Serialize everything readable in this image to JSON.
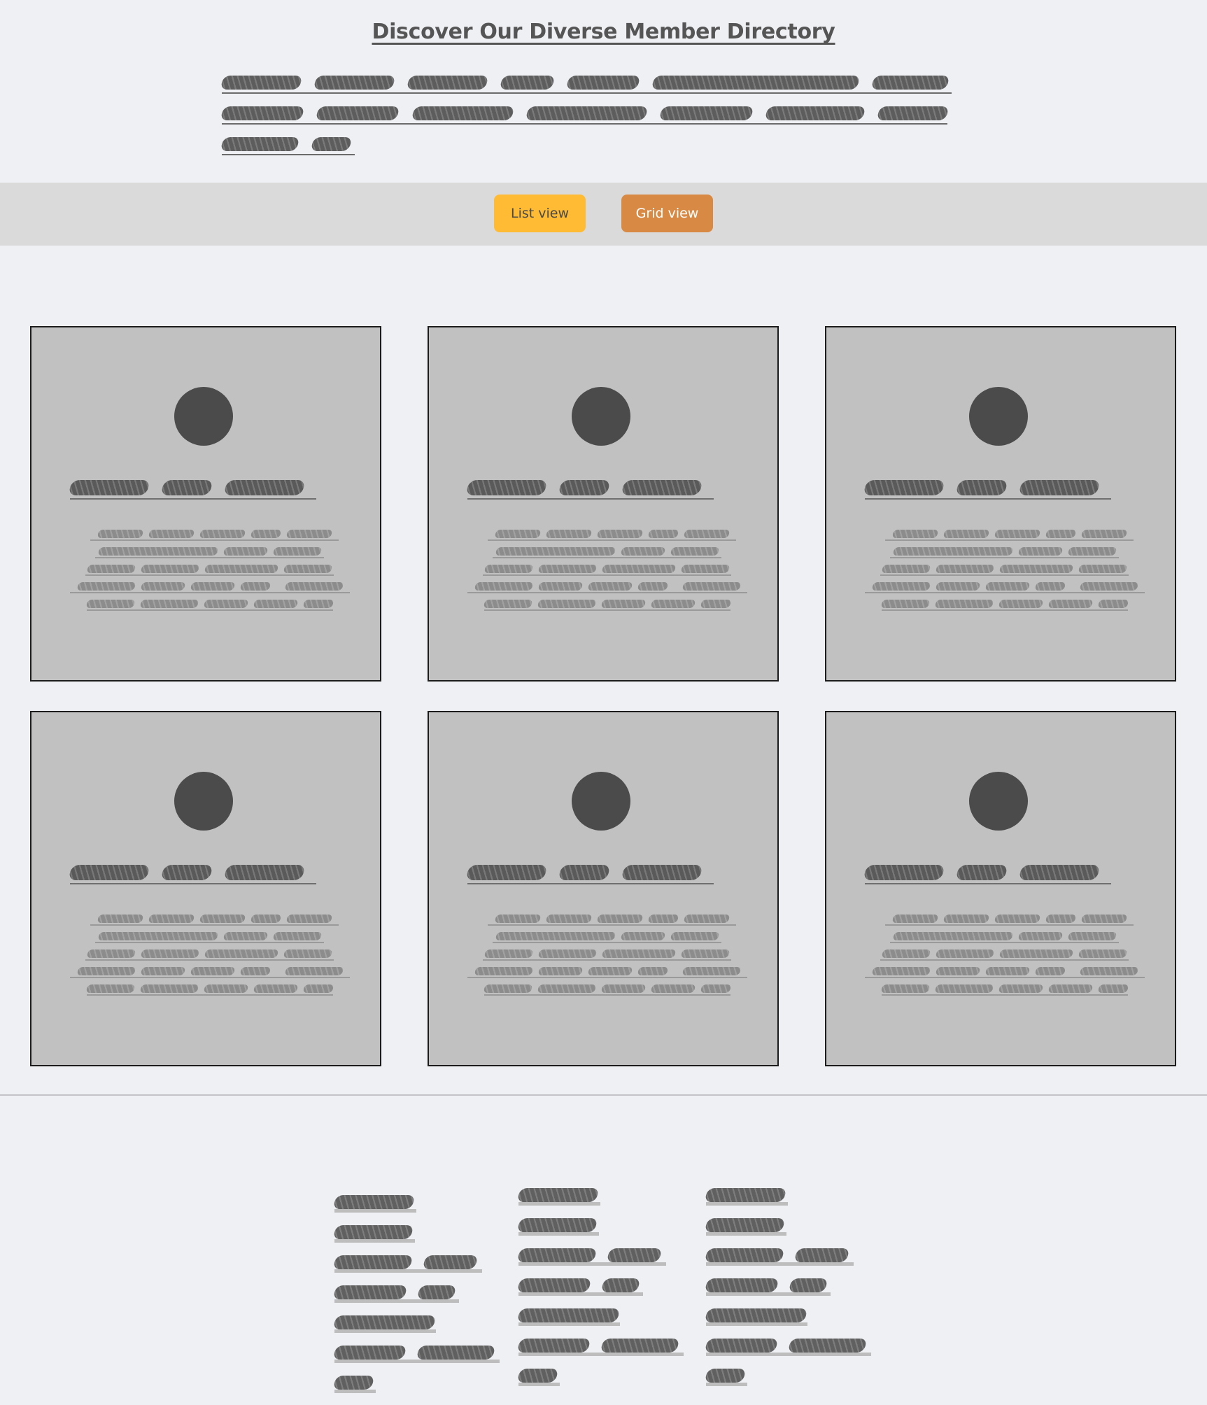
{
  "header": {
    "title": "Discover Our Diverse Member Directory"
  },
  "view_toggle": {
    "list_label": "List view",
    "grid_label": "Grid view",
    "colors": {
      "list": "#ffbb34",
      "grid": "#d88a45",
      "toolbar_bg": "#dadada"
    }
  },
  "members": {
    "count_shown": 6,
    "card_color": "#c1c1c1",
    "avatar_color": "#4b4b4b",
    "text_legible": false
  },
  "colors": {
    "page_background": "#eff0f4",
    "title_text": "#555555"
  }
}
